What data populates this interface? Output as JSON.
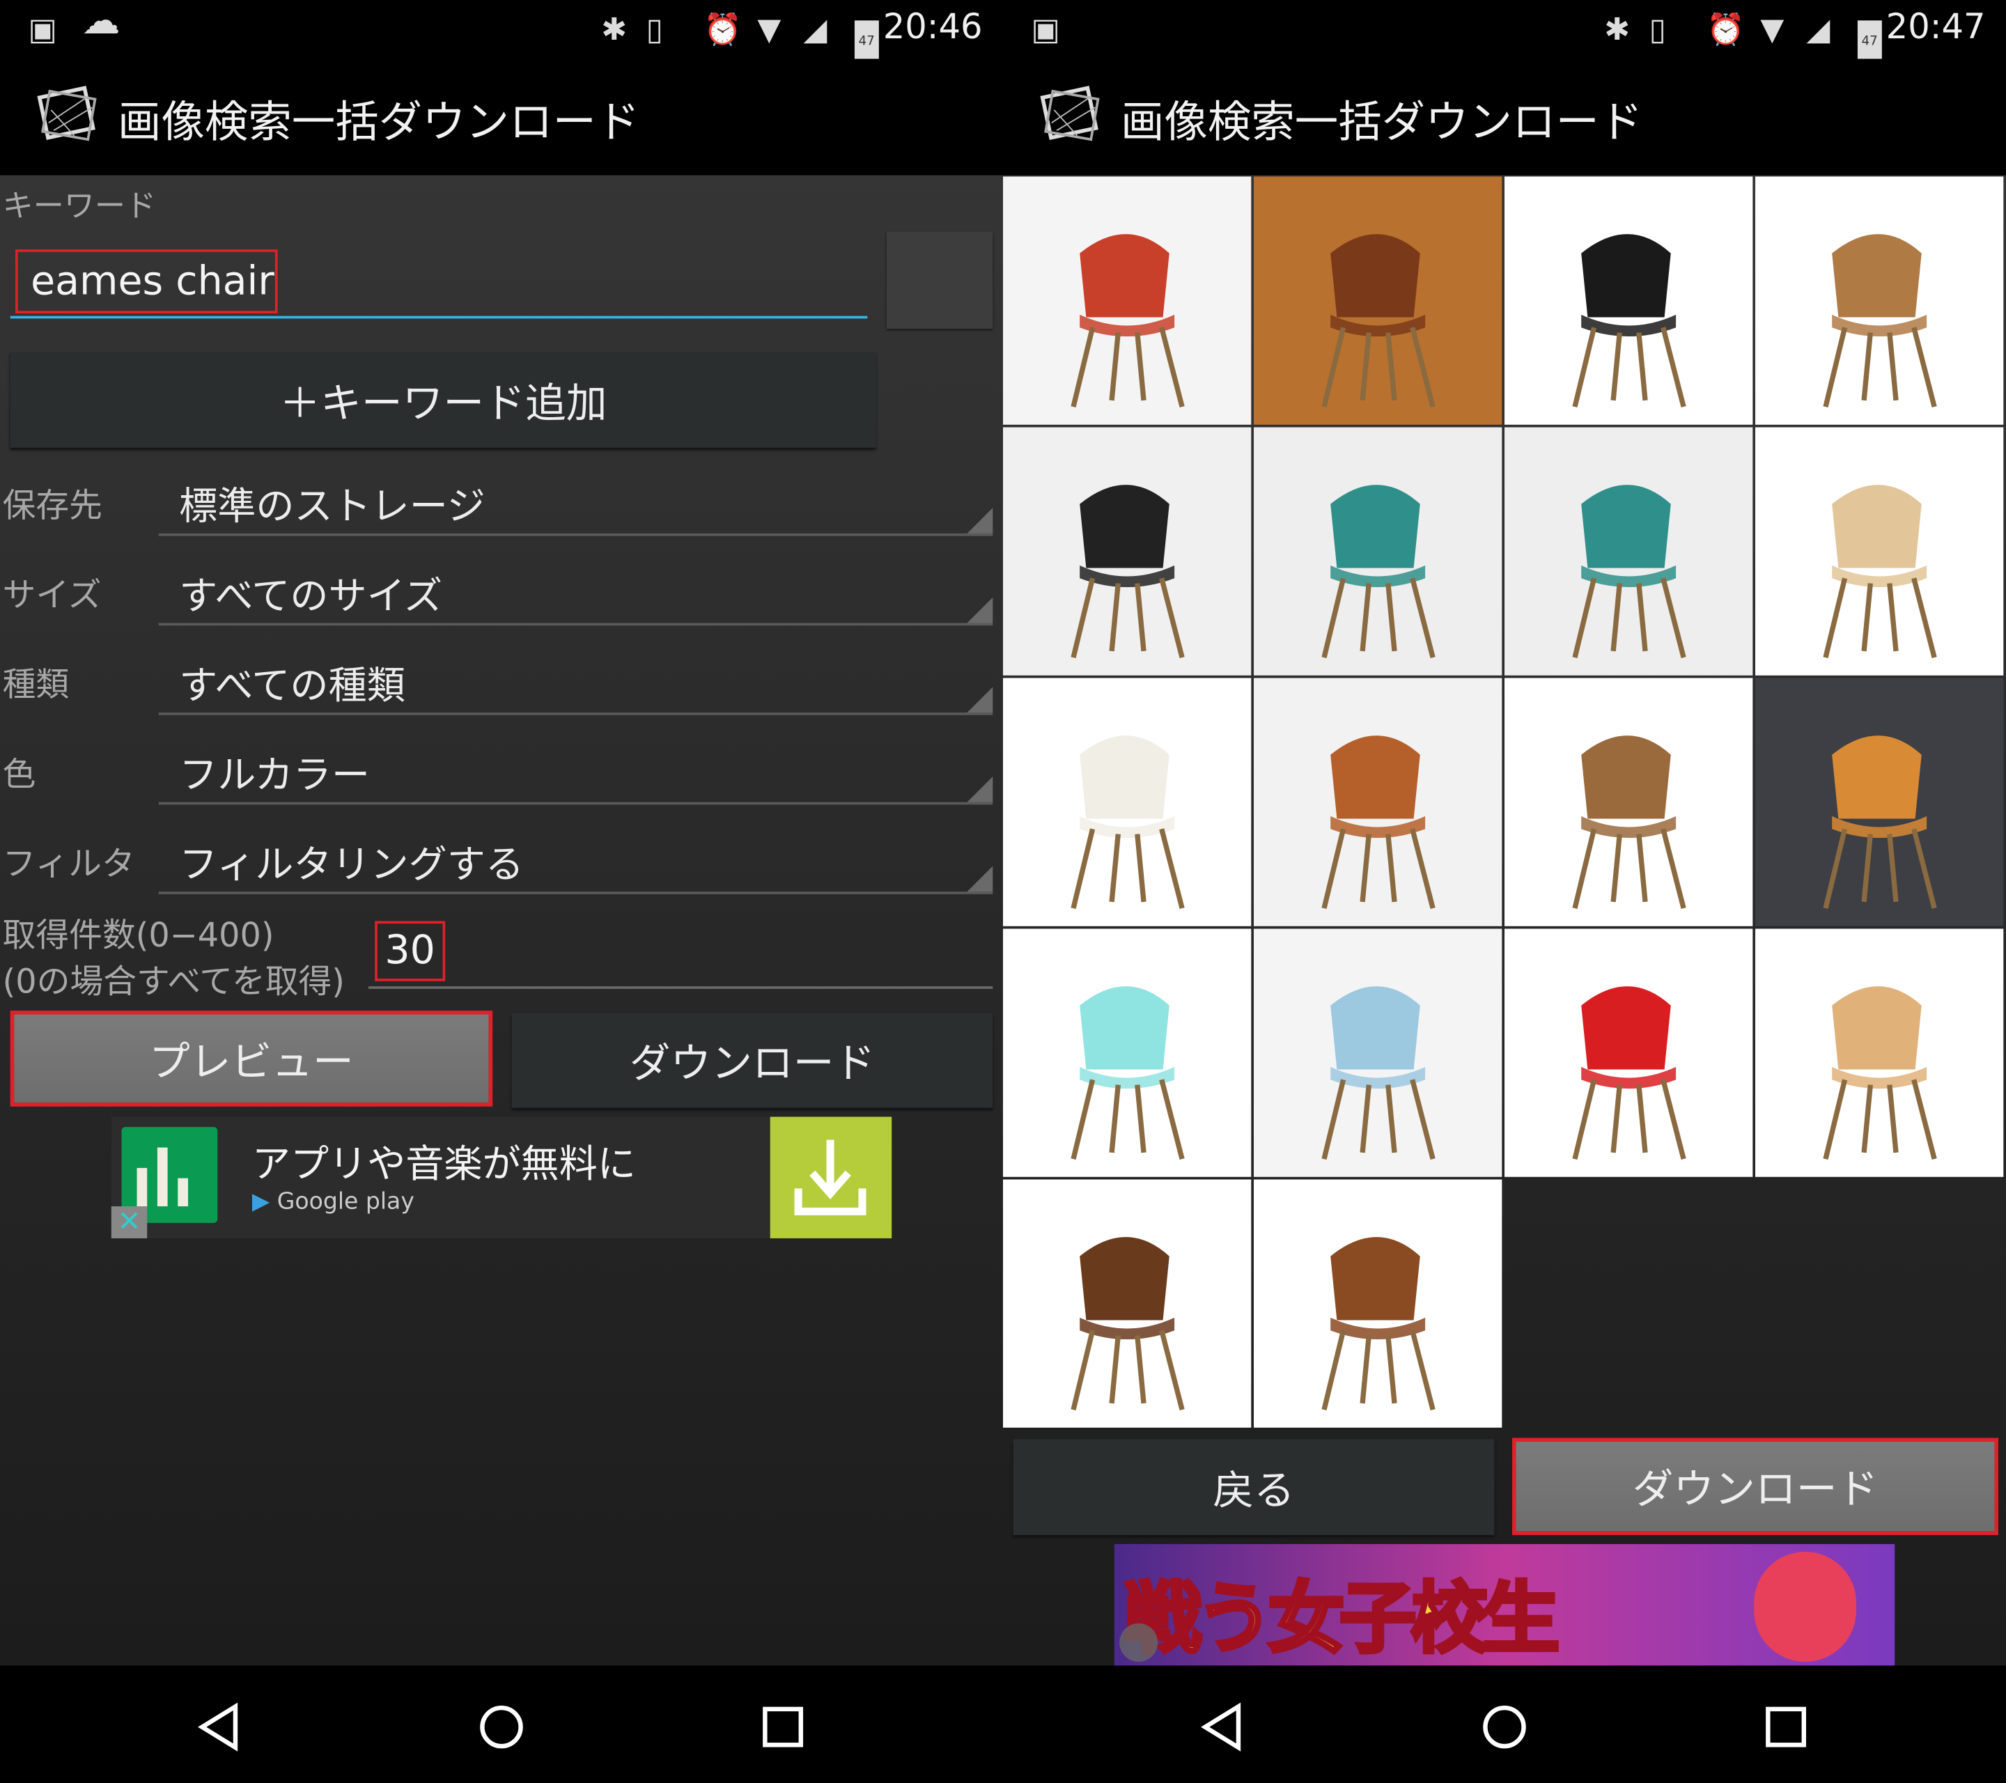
{
  "left": {
    "status_bar": {
      "time": "20:46",
      "battery": "47"
    },
    "app_title": "画像検索一括ダウンロード",
    "keyword_label": "キーワード",
    "keyword_value": "eames chair",
    "add_keyword_button": "＋キーワード追加",
    "settings": [
      {
        "label": "保存先",
        "value": "標準のストレージ"
      },
      {
        "label": "サイズ",
        "value": "すべてのサイズ"
      },
      {
        "label": "種類",
        "value": "すべての種類"
      },
      {
        "label": "色",
        "value": "フルカラー"
      },
      {
        "label": "フィルタ",
        "value": "フィルタリングする"
      }
    ],
    "count_label_line1": "取得件数(0−400)",
    "count_label_line2": "(0の場合すべてを取得)",
    "count_value": "30",
    "preview_button": "プレビュー",
    "download_button": "ダウンロード",
    "ad": {
      "text": "アプリや音楽が無料に",
      "store": "Google play",
      "accent": "#b5cc3b"
    }
  },
  "right": {
    "status_bar": {
      "time": "20:47",
      "battery": "47"
    },
    "app_title": "画像検索一括ダウンロード",
    "images": [
      {
        "bg": "#f4f4f4",
        "seat": "#c8402a"
      },
      {
        "bg": "#b8712e",
        "seat": "#7a3a1a"
      },
      {
        "bg": "#ffffff",
        "seat": "#1a1a1a"
      },
      {
        "bg": "#ffffff",
        "seat": "#b07a45"
      },
      {
        "bg": "#f0f0f0",
        "seat": "#222222"
      },
      {
        "bg": "#eeeeee",
        "seat": "#2f8f8a"
      },
      {
        "bg": "#eeeeee",
        "seat": "#2f8f8a"
      },
      {
        "bg": "#ffffff",
        "seat": "#e2c598"
      },
      {
        "bg": "#ffffff",
        "seat": "#f1eee6"
      },
      {
        "bg": "#f2f2f2",
        "seat": "#b5602a"
      },
      {
        "bg": "#ffffff",
        "seat": "#9a6a3c"
      },
      {
        "bg": "#3d3f44",
        "seat": "#d98a34"
      },
      {
        "bg": "#ffffff",
        "seat": "#8fe3e0"
      },
      {
        "bg": "#f4f4f4",
        "seat": "#9cc8e0"
      },
      {
        "bg": "#ffffff",
        "seat": "#d91e22"
      },
      {
        "bg": "#ffffff",
        "seat": "#e0b27a"
      },
      {
        "bg": "#ffffff",
        "seat": "#6a3a1c"
      },
      {
        "bg": "#ffffff",
        "seat": "#8a4a22"
      }
    ],
    "back_button": "戻る",
    "download_button": "ダウンロード",
    "ad_banner_text": "戦う女子校生"
  },
  "highlight_color": "#e0202a",
  "input_accent": "#33b5e5"
}
